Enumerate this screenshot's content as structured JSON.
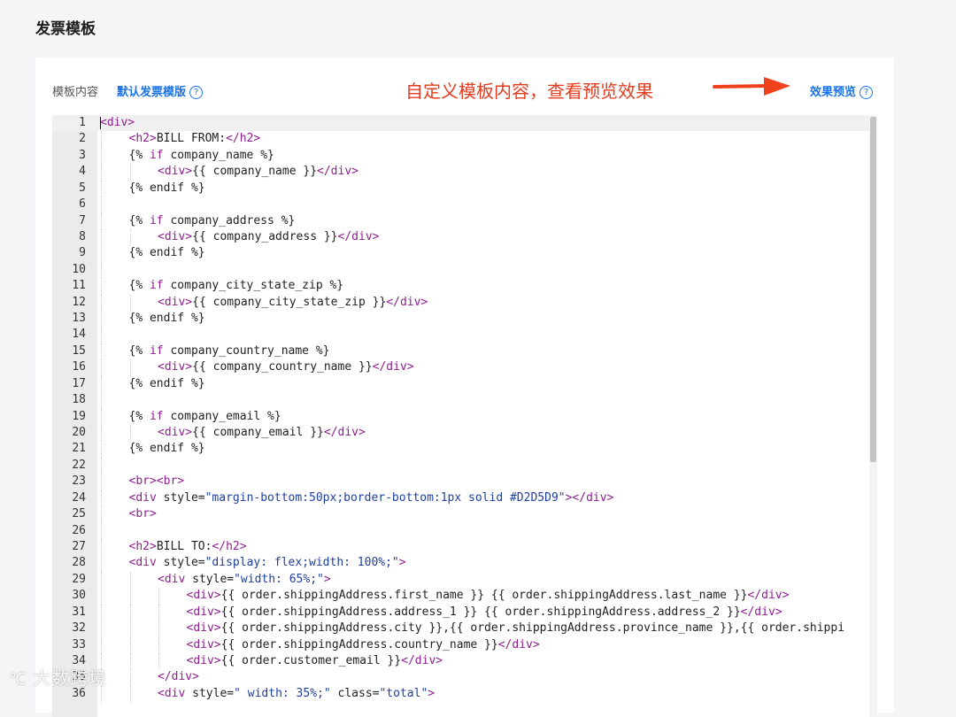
{
  "page": {
    "title": "发票模板"
  },
  "toolbar": {
    "field_label": "模板内容",
    "default_template_link": "默认发票模版",
    "help_glyph": "?",
    "annotation": "自定义模板内容，查看预览效果",
    "annotation_color": "#e53c1f",
    "preview_link": "效果预览",
    "link_color": "#1a73e8"
  },
  "editor": {
    "lines": [
      {
        "n": "1",
        "tokens": [
          [
            "tag",
            "<div>"
          ]
        ],
        "indent": 0
      },
      {
        "n": "2",
        "tokens": [
          [
            "tag",
            "<h2>"
          ],
          [
            "txt",
            "BILL FROM:"
          ],
          [
            "tag",
            "</h2>"
          ]
        ],
        "indent": 1
      },
      {
        "n": "3",
        "tokens": [
          [
            "txt",
            "{% "
          ],
          [
            "kw",
            "if"
          ],
          [
            "txt",
            " company_name %}"
          ]
        ],
        "indent": 1
      },
      {
        "n": "4",
        "tokens": [
          [
            "tag",
            "<div>"
          ],
          [
            "txt",
            "{{ company_name }}"
          ],
          [
            "tag",
            "</div>"
          ]
        ],
        "indent": 2
      },
      {
        "n": "5",
        "tokens": [
          [
            "txt",
            "{% endif %}"
          ]
        ],
        "indent": 1
      },
      {
        "n": "6",
        "tokens": [],
        "indent": 1
      },
      {
        "n": "7",
        "tokens": [
          [
            "txt",
            "{% "
          ],
          [
            "kw",
            "if"
          ],
          [
            "txt",
            " company_address %}"
          ]
        ],
        "indent": 1
      },
      {
        "n": "8",
        "tokens": [
          [
            "tag",
            "<div>"
          ],
          [
            "txt",
            "{{ company_address }}"
          ],
          [
            "tag",
            "</div>"
          ]
        ],
        "indent": 2
      },
      {
        "n": "9",
        "tokens": [
          [
            "txt",
            "{% endif %}"
          ]
        ],
        "indent": 1
      },
      {
        "n": "10",
        "tokens": [],
        "indent": 1
      },
      {
        "n": "11",
        "tokens": [
          [
            "txt",
            "{% "
          ],
          [
            "kw",
            "if"
          ],
          [
            "txt",
            " company_city_state_zip %}"
          ]
        ],
        "indent": 1
      },
      {
        "n": "12",
        "tokens": [
          [
            "tag",
            "<div>"
          ],
          [
            "txt",
            "{{ company_city_state_zip }}"
          ],
          [
            "tag",
            "</div>"
          ]
        ],
        "indent": 2
      },
      {
        "n": "13",
        "tokens": [
          [
            "txt",
            "{% endif %}"
          ]
        ],
        "indent": 1
      },
      {
        "n": "14",
        "tokens": [],
        "indent": 1
      },
      {
        "n": "15",
        "tokens": [
          [
            "txt",
            "{% "
          ],
          [
            "kw",
            "if"
          ],
          [
            "txt",
            " company_country_name %}"
          ]
        ],
        "indent": 1
      },
      {
        "n": "16",
        "tokens": [
          [
            "tag",
            "<div>"
          ],
          [
            "txt",
            "{{ company_country_name }}"
          ],
          [
            "tag",
            "</div>"
          ]
        ],
        "indent": 2
      },
      {
        "n": "17",
        "tokens": [
          [
            "txt",
            "{% endif %}"
          ]
        ],
        "indent": 1
      },
      {
        "n": "18",
        "tokens": [],
        "indent": 1
      },
      {
        "n": "19",
        "tokens": [
          [
            "txt",
            "{% "
          ],
          [
            "kw",
            "if"
          ],
          [
            "txt",
            " company_email %}"
          ]
        ],
        "indent": 1
      },
      {
        "n": "20",
        "tokens": [
          [
            "tag",
            "<div>"
          ],
          [
            "txt",
            "{{ company_email }}"
          ],
          [
            "tag",
            "</div>"
          ]
        ],
        "indent": 2
      },
      {
        "n": "21",
        "tokens": [
          [
            "txt",
            "{% endif %}"
          ]
        ],
        "indent": 1
      },
      {
        "n": "22",
        "tokens": [],
        "indent": 1
      },
      {
        "n": "23",
        "tokens": [
          [
            "tag",
            "<br><br>"
          ]
        ],
        "indent": 1
      },
      {
        "n": "24",
        "tokens": [
          [
            "tag",
            "<div "
          ],
          [
            "txt",
            "style="
          ],
          [
            "str",
            "\"margin-bottom:50px;border-bottom:1px solid #D2D5D9\""
          ],
          [
            "tag",
            "></div>"
          ]
        ],
        "indent": 1
      },
      {
        "n": "25",
        "tokens": [
          [
            "tag",
            "<br>"
          ]
        ],
        "indent": 1
      },
      {
        "n": "26",
        "tokens": [],
        "indent": 1
      },
      {
        "n": "27",
        "tokens": [
          [
            "tag",
            "<h2>"
          ],
          [
            "txt",
            "BILL TO:"
          ],
          [
            "tag",
            "</h2>"
          ]
        ],
        "indent": 1
      },
      {
        "n": "28",
        "tokens": [
          [
            "tag",
            "<div "
          ],
          [
            "txt",
            "style="
          ],
          [
            "str",
            "\"display: flex;width: 100%;\""
          ],
          [
            "tag",
            ">"
          ]
        ],
        "indent": 1
      },
      {
        "n": "29",
        "tokens": [
          [
            "tag",
            "<div "
          ],
          [
            "txt",
            "style="
          ],
          [
            "str",
            "\"width: 65%;\""
          ],
          [
            "tag",
            ">"
          ]
        ],
        "indent": 2
      },
      {
        "n": "30",
        "tokens": [
          [
            "tag",
            "<div>"
          ],
          [
            "txt",
            "{{ order.shippingAddress.first_name }} {{ order.shippingAddress.last_name }}"
          ],
          [
            "tag",
            "</div>"
          ]
        ],
        "indent": 3
      },
      {
        "n": "31",
        "tokens": [
          [
            "tag",
            "<div>"
          ],
          [
            "txt",
            "{{ order.shippingAddress.address_1 }} {{ order.shippingAddress.address_2 }}"
          ],
          [
            "tag",
            "</div>"
          ]
        ],
        "indent": 3
      },
      {
        "n": "32",
        "tokens": [
          [
            "tag",
            "<div>"
          ],
          [
            "txt",
            "{{ order.shippingAddress.city }},{{ order.shippingAddress.province_name }},{{ order.shippi"
          ]
        ],
        "indent": 3
      },
      {
        "n": "33",
        "tokens": [
          [
            "tag",
            "<div>"
          ],
          [
            "txt",
            "{{ order.shippingAddress.country_name }}"
          ],
          [
            "tag",
            "</div>"
          ]
        ],
        "indent": 3
      },
      {
        "n": "34",
        "tokens": [
          [
            "tag",
            "<div>"
          ],
          [
            "txt",
            "{{ order.customer_email }}"
          ],
          [
            "tag",
            "</div>"
          ]
        ],
        "indent": 3
      },
      {
        "n": "35",
        "tokens": [
          [
            "tag",
            "</div>"
          ]
        ],
        "indent": 2
      },
      {
        "n": "36",
        "tokens": [
          [
            "tag",
            "<div "
          ],
          [
            "txt",
            "style="
          ],
          [
            "str",
            "\" width: 35%;\""
          ],
          [
            "txt",
            " class="
          ],
          [
            "str",
            "\"total\""
          ],
          [
            "tag",
            ">"
          ]
        ],
        "indent": 2
      }
    ]
  },
  "watermark": {
    "text": "大数跨境"
  }
}
